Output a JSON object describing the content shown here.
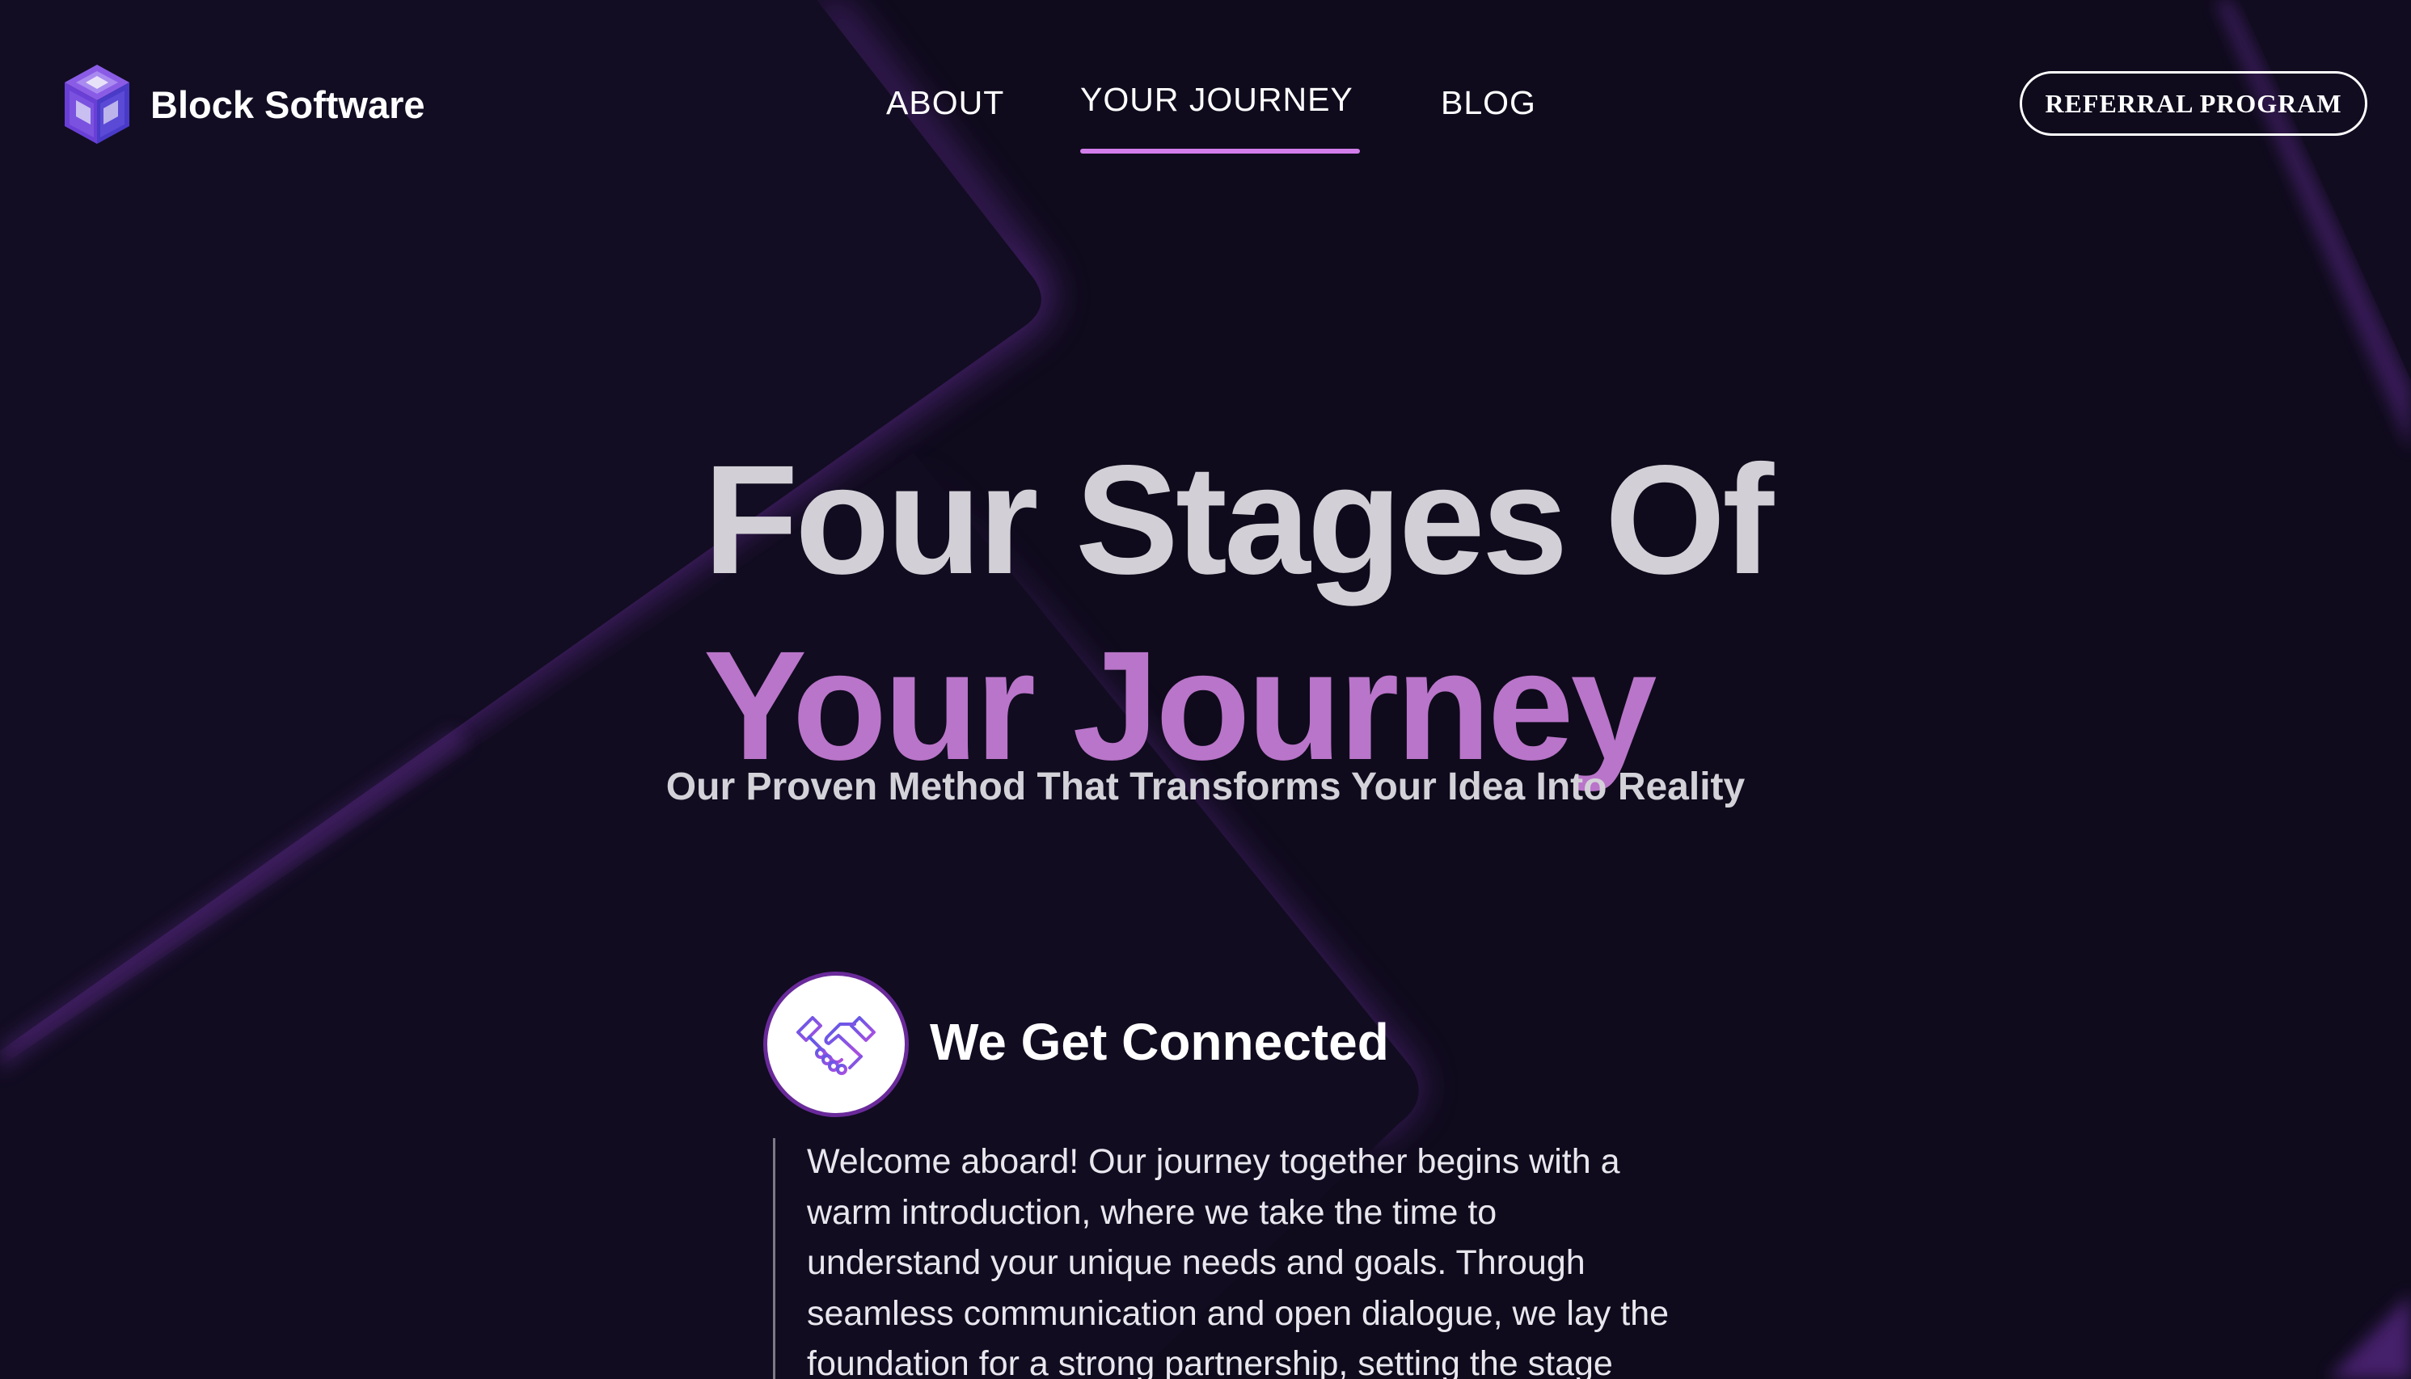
{
  "brand": {
    "name": "Block Software",
    "icon": "cube-grid-logo-icon"
  },
  "nav": {
    "items": [
      {
        "label": "ABOUT",
        "active": false
      },
      {
        "label": "YOUR JOURNEY",
        "active": true
      },
      {
        "label": "BLOG",
        "active": false
      }
    ],
    "active_underline_color": "#d27dea"
  },
  "header": {
    "referral_label": "REFERRAL PROGRAM"
  },
  "hero": {
    "title_line1": "Four Stages Of",
    "title_line2": "Your Journey",
    "subtitle": "Our Proven Method That Transforms Your Idea Into Reality"
  },
  "stages": [
    {
      "icon": "handshake-icon",
      "title": "We Get Connected",
      "body": "Welcome aboard! Our journey together begins with a warm introduction, where we take the time to understand your unique needs and goals. Through seamless communication and open dialogue, we lay the foundation for a strong partnership, setting the stage"
    }
  ],
  "colors": {
    "background": "#0f0b1c",
    "accent_purple": "#b975c9",
    "heading_light": "#d2d0d6",
    "shape_edge": "#6a2fa0"
  }
}
